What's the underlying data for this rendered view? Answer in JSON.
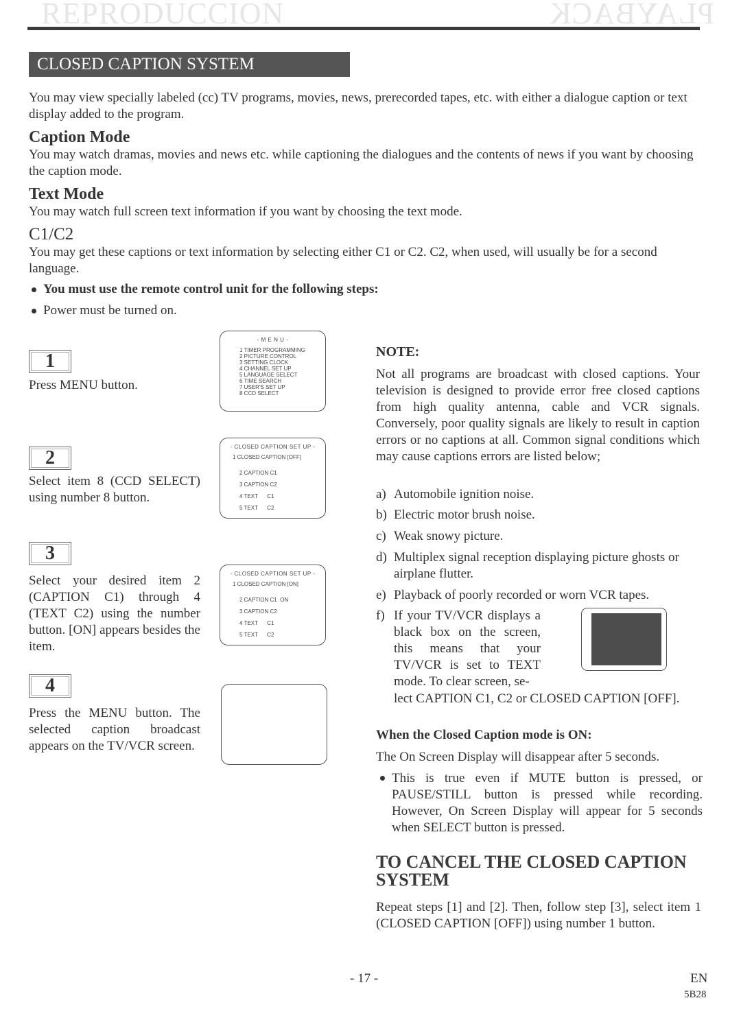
{
  "header": {
    "ghost_left": "REPRODUCCION",
    "ghost_right": "PLAYBACK",
    "banner_title": "CLOSED CAPTION SYSTEM"
  },
  "intro": "You may view specially labeled (cc) TV programs, movies, news, prerecorded tapes, etc. with either a dialogue caption or text display added to the program.",
  "sections": [
    {
      "heading": "Caption Mode",
      "body": "You may watch dramas, movies and news etc. while captioning the dialogues and the contents of news if you want by choosing the caption mode."
    },
    {
      "heading": "Text Mode",
      "body": "You may watch full screen text information if you want by choosing the text mode."
    },
    {
      "heading": "C1/C2",
      "body": "You may get these captions or text information by selecting either C1 or C2. C2, when used, will usually be for a second language."
    }
  ],
  "bullets": [
    {
      "text": "You must use the remote control unit for the following steps:",
      "bold": true
    },
    {
      "text": "Power must be turned on.",
      "bold": false
    }
  ],
  "steps": [
    {
      "number": "1",
      "text": "Press MENU button."
    },
    {
      "number": "2",
      "text": "Select item 8 (CCD SELECT) using number 8 button."
    },
    {
      "number": "3",
      "text": "Select your desired item 2 (CAPTION C1) through 4 (TEXT C2) using the number button. [ON] appears besides the item."
    },
    {
      "number": "4",
      "text": "Press the MENU button. The selected caption broadcast appears on the TV/VCR screen."
    }
  ],
  "screens": {
    "menu": {
      "title": "- M E N U -",
      "items": [
        "1 TIMER PROGRAMMING",
        "2 PICTURE CONTROL",
        "3 SETTING CLOCK",
        "4 CHANNEL SET UP",
        "5 LANGUAGE SELECT",
        "6 TIME SEARCH",
        "7 USER'S SET UP",
        "8 CCD SELECT"
      ]
    },
    "cc_off": {
      "title": "- CLOSED CAPTION SET UP -",
      "items": [
        {
          "label": "1 CLOSED CAPTION [OFF]",
          "value": ""
        },
        {
          "label": "2 CAPTION C1",
          "value": ""
        },
        {
          "label": "3 CAPTION C2",
          "value": ""
        },
        {
          "label": "4 TEXT      C1",
          "value": ""
        },
        {
          "label": "5 TEXT      C2",
          "value": ""
        }
      ]
    },
    "cc_on": {
      "title": "- CLOSED CAPTION SET UP -",
      "items": [
        {
          "label": "1 CLOSED CAPTION [ON]",
          "value": ""
        },
        {
          "label": "2 CAPTION C1",
          "value": "ON"
        },
        {
          "label": "3 CAPTION C2",
          "value": ""
        },
        {
          "label": "4 TEXT      C1",
          "value": ""
        },
        {
          "label": "5 TEXT      C2",
          "value": ""
        }
      ]
    }
  },
  "note": {
    "title": "NOTE:",
    "body": "Not all programs are broadcast with closed captions. Your television is designed to provide error free closed captions from high quality antenna, cable and VCR signals. Conversely, poor quality signals are likely to result in caption errors or no captions at all. Common signal conditions which may cause captions errors are listed below;",
    "items": [
      {
        "label": "a)",
        "text": "Automobile ignition noise."
      },
      {
        "label": "b)",
        "text": "Electric motor brush noise."
      },
      {
        "label": "c)",
        "text": "Weak snowy picture."
      },
      {
        "label": "d)",
        "text": "Multiplex signal reception displaying picture ghosts or airplane flutter."
      },
      {
        "label": "e)",
        "text": "Playback of poorly recorded or worn VCR tapes."
      },
      {
        "label": "f)",
        "text_short": "If your TV/VCR displays a black box on the screen, this means that your TV/VCR is set to TEXT mode. To clear screen, se-",
        "text_cont": "lect CAPTION C1, C2 or CLOSED CAPTION [OFF]."
      }
    ]
  },
  "cc_on_section": {
    "heading": "When the Closed Caption mode is ON:",
    "body": "The On Screen Display will disappear after 5 seconds.",
    "bullet": "This is true even if MUTE button is pressed, or PAUSE/STILL button is pressed while recording. However, On Screen Display will appear for 5 seconds when SELECT button is pressed."
  },
  "cancel": {
    "heading": "TO CANCEL THE CLOSED CAPTION SYSTEM",
    "body": "Repeat steps [1] and [2]. Then, follow step [3], select item 1 (CLOSED CAPTION [OFF]) using number 1 button."
  },
  "footer": {
    "page_number": "- 17 -",
    "lang": "EN",
    "code": "5B28"
  }
}
